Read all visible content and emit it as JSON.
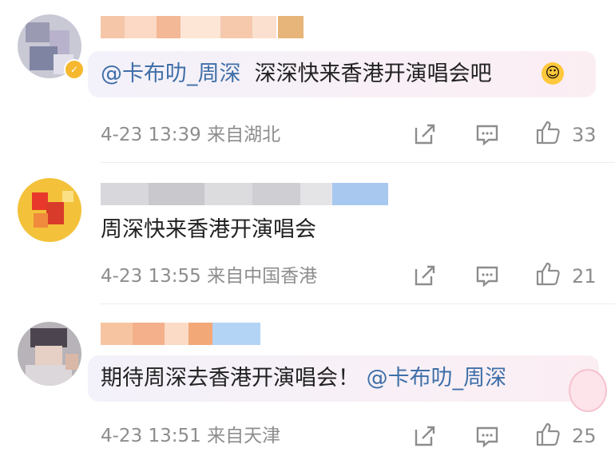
{
  "comments": [
    {
      "text_mention": "@卡布叻_周深",
      "text_body": "深深快来香港开演唱会吧",
      "timestamp": "4-23 13:39",
      "source": "来自湖北",
      "likes": "33"
    },
    {
      "text_body": "周深快来香港开演唱会",
      "timestamp": "4-23 13:55",
      "source": "来自中国香港",
      "likes": "21"
    },
    {
      "text_body": "期待周深去香港开演唱会！",
      "text_mention": "@卡布叻_周深",
      "timestamp": "4-23 13:51",
      "source": "来自天津",
      "likes": "25"
    }
  ],
  "icons": {
    "share": "share-icon",
    "comment": "comment-icon",
    "like": "thumbs-up-icon"
  },
  "colors": {
    "mention": "#3f6fa8",
    "meta": "#8d8d8d",
    "text": "#222222"
  }
}
